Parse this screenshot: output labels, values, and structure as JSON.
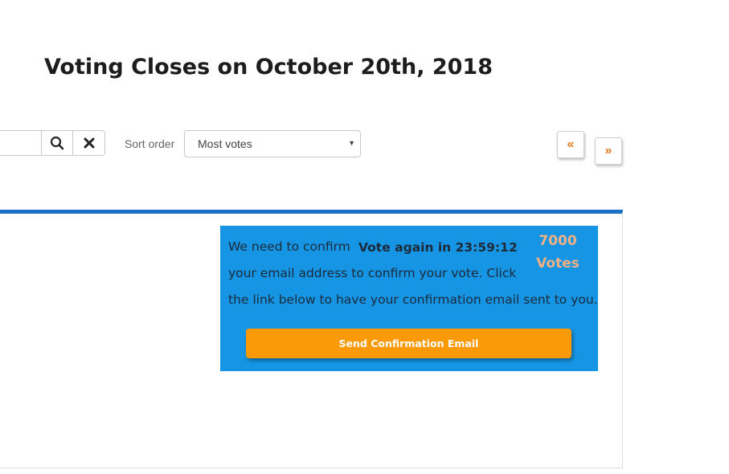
{
  "header": {
    "title": "Voting Closes on October 20th, 2018"
  },
  "toolbar": {
    "search": {
      "value": "",
      "placeholder": ""
    },
    "search_icon": "search-icon",
    "clear_icon": "close-icon",
    "sort_label": "Sort order",
    "sort_selected": "Most votes",
    "pager": {
      "prev_label": "«",
      "next_label": "»"
    }
  },
  "vote_panel": {
    "confirm_text_line1": "We need to confirm",
    "confirm_text_line2": "your email address to confirm your vote. Click",
    "confirm_text_line3": "the link below to have your confirmation email sent to you.",
    "countdown": "Vote again in 23:59:12",
    "vote_count": "7000",
    "vote_unit": "Votes",
    "send_button_label": "Send Confirmation Email"
  },
  "colors": {
    "accent_blue": "#1a6fc4",
    "vote_box_bg": "#1595e3",
    "button_orange": "#fb9a08",
    "pager_arrow": "#e87722",
    "vote_count": "#f3b083"
  }
}
